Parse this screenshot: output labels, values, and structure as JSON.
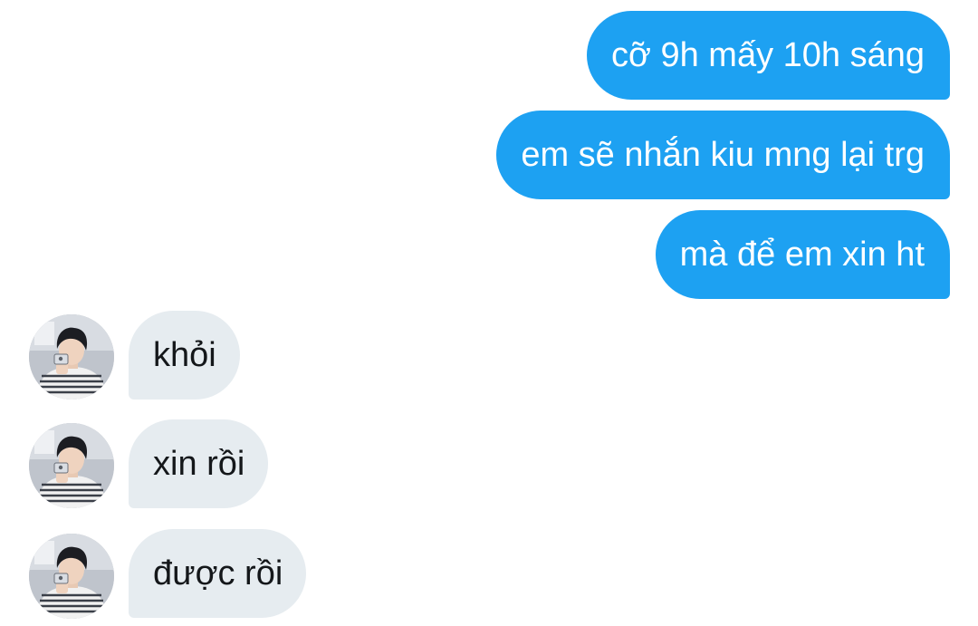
{
  "conversation": {
    "sent": [
      {
        "text": "cỡ 9h mấy 10h sáng"
      },
      {
        "text": "em sẽ nhắn kiu mng lại trg"
      },
      {
        "text": "mà để em xin ht"
      }
    ],
    "received": [
      {
        "text": "khỏi",
        "avatar": "profile-photo"
      },
      {
        "text": "xin rồi",
        "avatar": "profile-photo"
      },
      {
        "text": "được rồi",
        "avatar": "profile-photo"
      }
    ]
  },
  "colors": {
    "sent_bubble": "#1da1f2",
    "received_bubble": "#e6ecf0",
    "sent_text": "#ffffff",
    "received_text": "#14171a",
    "background": "#ffffff"
  }
}
